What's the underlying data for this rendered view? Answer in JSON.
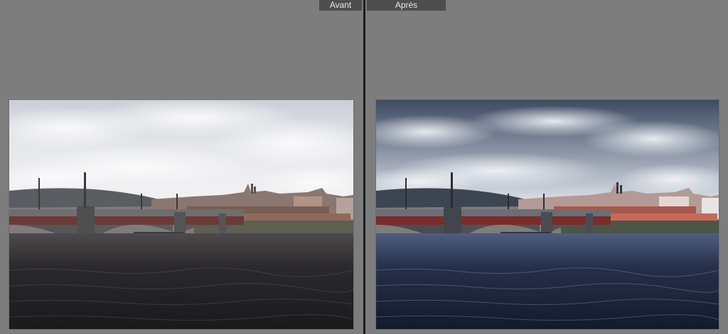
{
  "compare_view": {
    "before_label": "Avant",
    "after_label": "Après"
  },
  "icons": {
    "before_photo": "bridge-city-photo",
    "after_photo": "bridge-city-photo"
  },
  "colors": {
    "background": "#7d7d7d",
    "divider": "#1e1e1e",
    "tab_background": "#4e4e4e",
    "tab_text": "#e8e8e8"
  }
}
